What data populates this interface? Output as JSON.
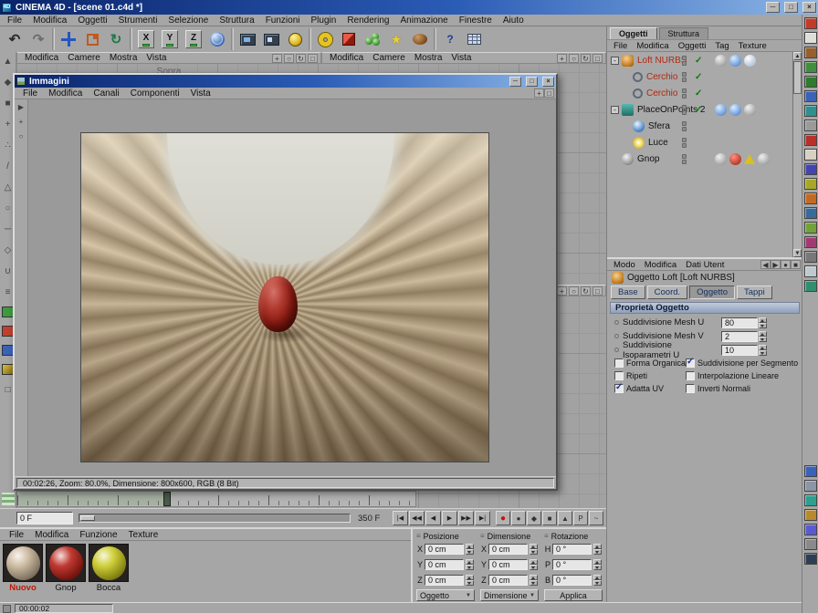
{
  "titlebar": {
    "title": "CINEMA 4D - [scene 01.c4d *]"
  },
  "menubar": {
    "items": [
      "File",
      "Modifica",
      "Oggetti",
      "Strumenti",
      "Selezione",
      "Struttura",
      "Funzioni",
      "Plugin",
      "Rendering",
      "Animazione",
      "Finestre",
      "Aiuto"
    ]
  },
  "viewport": {
    "menu": [
      "Modifica",
      "Camere",
      "Mostra",
      "Vista"
    ],
    "top_label": "Sopra"
  },
  "picture_viewer": {
    "title": "Immagini",
    "menu": [
      "File",
      "Modifica",
      "Canali",
      "Componenti",
      "Vista"
    ],
    "status": "00:02:26, Zoom: 80.0%, Dimensione: 800x600, RGB (8 Bit)"
  },
  "object_manager": {
    "tabs": [
      "Oggetti",
      "Struttura"
    ],
    "menu": [
      "File",
      "Modifica",
      "Oggetti",
      "Tag",
      "Texture"
    ],
    "objects": [
      {
        "name": "Loft NURBS",
        "color": "#b02810",
        "icon": "loft-nurbs-icon"
      },
      {
        "name": "Cerchio",
        "color": "#b02810",
        "icon": "circle-spline-icon"
      },
      {
        "name": "Cerchio",
        "color": "#b02810",
        "icon": "circle-spline-icon"
      },
      {
        "name": "PlaceOnPoints 2",
        "color": "#101010",
        "icon": "plugin-object-icon"
      },
      {
        "name": "Sfera",
        "color": "#101010",
        "icon": "sphere-icon"
      },
      {
        "name": "Luce",
        "color": "#101010",
        "icon": "light-icon"
      },
      {
        "name": "Gnop",
        "color": "#101010",
        "icon": "polygon-object-icon"
      }
    ]
  },
  "attribute_manager": {
    "menu": [
      "Modo",
      "Modifica",
      "Dati Utent"
    ],
    "title": "Oggetto Loft [Loft NURBS]",
    "tabs": [
      "Base",
      "Coord.",
      "Oggetto",
      "Tappi"
    ],
    "active_tab": "Oggetto",
    "section": "Proprietà Oggetto",
    "fields": [
      {
        "label": "Suddivisione Mesh U",
        "value": "80"
      },
      {
        "label": "Suddivisione Mesh V",
        "value": "2"
      },
      {
        "label": "Suddivisione Isoparametri U",
        "value": "10"
      }
    ],
    "checkboxes": [
      {
        "label": "Forma Organica",
        "checked": false
      },
      {
        "label": "Suddivisione per Segmento",
        "checked": true
      },
      {
        "label": "Ripeti",
        "checked": false
      },
      {
        "label": "Interpolazione Lineare",
        "checked": false
      },
      {
        "label": "Adatta UV",
        "checked": true
      },
      {
        "label": "Inverti Normali",
        "checked": false
      }
    ]
  },
  "timeline": {
    "current": "0 F",
    "end": "350 F"
  },
  "materials": {
    "menu": [
      "File",
      "Modifica",
      "Funzione",
      "Texture"
    ],
    "items": [
      {
        "name": "Nuovo",
        "color": "#c8b498",
        "selected": true
      },
      {
        "name": "Gnop",
        "color": "#b81f16"
      },
      {
        "name": "Bocca",
        "color": "#c8c81e"
      }
    ]
  },
  "coordinates": {
    "sections": [
      {
        "title": "Posizione",
        "rows": [
          {
            "axis": "X",
            "value": "0 cm"
          },
          {
            "axis": "Y",
            "value": "0 cm"
          },
          {
            "axis": "Z",
            "value": "0 cm"
          }
        ],
        "footer": "Oggetto"
      },
      {
        "title": "Dimensione",
        "rows": [
          {
            "axis": "X",
            "value": "0 cm"
          },
          {
            "axis": "Y",
            "value": "0 cm"
          },
          {
            "axis": "Z",
            "value": "0 cm"
          }
        ],
        "footer": "Dimensione"
      },
      {
        "title": "Rotazione",
        "rows": [
          {
            "axis": "H",
            "value": "0 °"
          },
          {
            "axis": "P",
            "value": "0 °"
          },
          {
            "axis": "B",
            "value": "0 °"
          }
        ],
        "footer": "Applica"
      }
    ]
  },
  "statusbar": {
    "time": "00:00:02"
  },
  "icons": {
    "app_badge": "4D",
    "undo": "↶",
    "redo": "↷",
    "rotate": "↻",
    "axis_x": "X",
    "axis_y": "Y",
    "axis_z": "Z",
    "help": "?",
    "star": "★",
    "vp_pan": "+",
    "vp_zoom": "○",
    "vp_rotate": "↻",
    "vp_max": "□",
    "win_min": "─",
    "win_max": "□",
    "win_close": "×",
    "check": "✓",
    "expand": "-",
    "grip": "≡",
    "dropdown": "▼",
    "back": "◀",
    "fwd": "▶",
    "dot": "●",
    "square": "■",
    "pointer": "▶",
    "hand": "+",
    "zoomtool": "○",
    "scroll_up": "▲",
    "scroll_down": "▼",
    "transport": [
      "|◀",
      "◀◀",
      "◀",
      "▶",
      "▶▶",
      "▶|"
    ],
    "keys": [
      "●",
      "●",
      "◆",
      "■",
      "▲",
      "P",
      "~"
    ]
  }
}
